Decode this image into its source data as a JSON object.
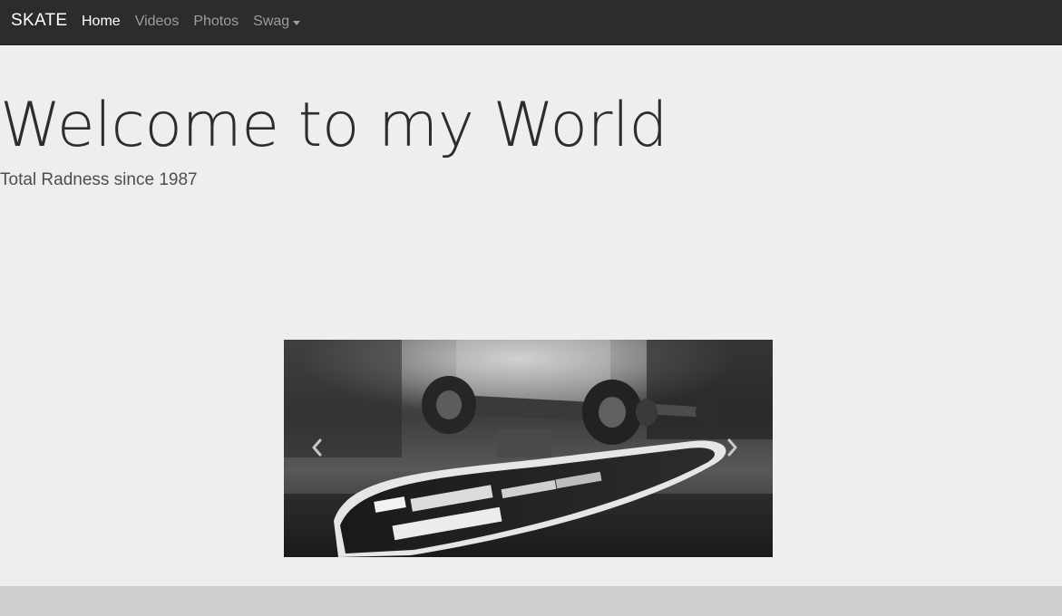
{
  "navbar": {
    "brand": "SKATE",
    "items": [
      {
        "label": "Home",
        "active": true
      },
      {
        "label": "Videos",
        "active": false
      },
      {
        "label": "Photos",
        "active": false
      },
      {
        "label": "Swag",
        "active": false,
        "dropdown": true
      }
    ]
  },
  "hero": {
    "title": "Welcome to my World",
    "subtitle": "Total Radness since 1987"
  },
  "carousel": {
    "image_subject": "black-and-white skateboard photo",
    "prev_icon": "chevron-left-icon",
    "next_icon": "chevron-right-icon"
  },
  "colors": {
    "navbar_bg": "#2b2c2e",
    "page_bg": "#eceef0",
    "footer_bg": "#cfcfd0",
    "nav_inactive": "#9d9d9d",
    "nav_active": "#ffffff"
  }
}
